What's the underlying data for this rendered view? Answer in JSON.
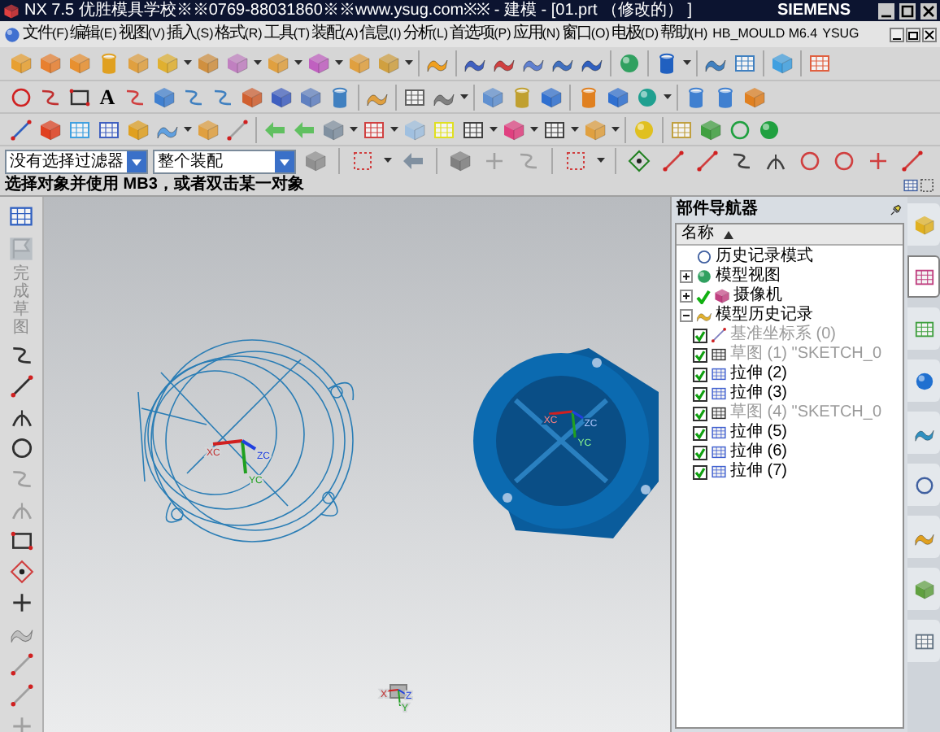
{
  "window": {
    "title": "NX 7.5 优胜模具学校※※0769-88031860※※www.ysug.com※※ - 建模 - [01.prt （修改的） ]",
    "brand": "SIEMENS"
  },
  "menu": {
    "items": [
      {
        "label": "文件",
        "key": "(F)"
      },
      {
        "label": "编辑",
        "key": "(E)"
      },
      {
        "label": "视图",
        "key": "(V)"
      },
      {
        "label": "插入",
        "key": "(S)"
      },
      {
        "label": "格式",
        "key": "(R)"
      },
      {
        "label": "工具",
        "key": "(T)"
      },
      {
        "label": "装配",
        "key": "(A)"
      },
      {
        "label": "信息",
        "key": "(I)"
      },
      {
        "label": "分析",
        "key": "(L)"
      },
      {
        "label": "首选项",
        "key": "(P)"
      },
      {
        "label": "应用",
        "key": "(N)"
      },
      {
        "label": "窗口",
        "key": "(O)"
      },
      {
        "label": "电极",
        "key": "(D)"
      },
      {
        "label": "帮助",
        "key": "(H)"
      }
    ],
    "extras": [
      "HB_MOULD M6.4",
      "YSUG"
    ]
  },
  "toolbar_glyph": "A",
  "selection_bar": {
    "filter": "没有选择过滤器",
    "scope": "整个装配"
  },
  "status_text": "选择对象并使用 MB3，或者双击某一对象",
  "sketch_toolbar": {
    "finish_label": "完成草图",
    "disabled": true
  },
  "viewport": {
    "triads": [
      {
        "x": "XC",
        "y": "YC",
        "z": "ZC"
      },
      {
        "x": "XC",
        "y": "YC",
        "z": "ZC"
      },
      {
        "x": "X",
        "y": "Y",
        "z": "Z"
      }
    ]
  },
  "navigator": {
    "title": "部件导航器",
    "column": "名称",
    "tree": [
      {
        "label": "历史记录模式",
        "kind": "mode",
        "checked": false
      },
      {
        "label": "模型视图",
        "kind": "views",
        "expanded": false,
        "checked": false
      },
      {
        "label": "摄像机",
        "kind": "camera",
        "expanded": false,
        "checked": true
      },
      {
        "label": "模型历史记录",
        "kind": "folder",
        "expanded": true,
        "checked": false,
        "children": [
          {
            "label": "基准坐标系 (0)",
            "kind": "datum",
            "checked": true,
            "disabled": true
          },
          {
            "label": "草图 (1) \"SKETCH_0",
            "kind": "sketch",
            "checked": true,
            "disabled": true
          },
          {
            "label": "拉伸 (2)",
            "kind": "extrude",
            "checked": true,
            "disabled": false
          },
          {
            "label": "拉伸 (3)",
            "kind": "extrude",
            "checked": true,
            "disabled": false
          },
          {
            "label": "草图 (4) \"SKETCH_0",
            "kind": "sketch",
            "checked": true,
            "disabled": true
          },
          {
            "label": "拉伸 (5)",
            "kind": "extrude",
            "checked": true,
            "disabled": false
          },
          {
            "label": "拉伸 (6)",
            "kind": "extrude",
            "checked": true,
            "disabled": false
          },
          {
            "label": "拉伸 (7)",
            "kind": "extrude",
            "checked": true,
            "disabled": false
          }
        ]
      }
    ]
  },
  "resource_tabs": [
    {
      "kind": "assembly",
      "selected": false
    },
    {
      "kind": "parts",
      "selected": true
    },
    {
      "kind": "library",
      "selected": false
    },
    {
      "kind": "info",
      "selected": false
    },
    {
      "kind": "web",
      "selected": false
    },
    {
      "kind": "history",
      "selected": false
    },
    {
      "kind": "palette",
      "selected": false
    },
    {
      "kind": "roles",
      "selected": false
    },
    {
      "kind": "system",
      "selected": false
    }
  ]
}
